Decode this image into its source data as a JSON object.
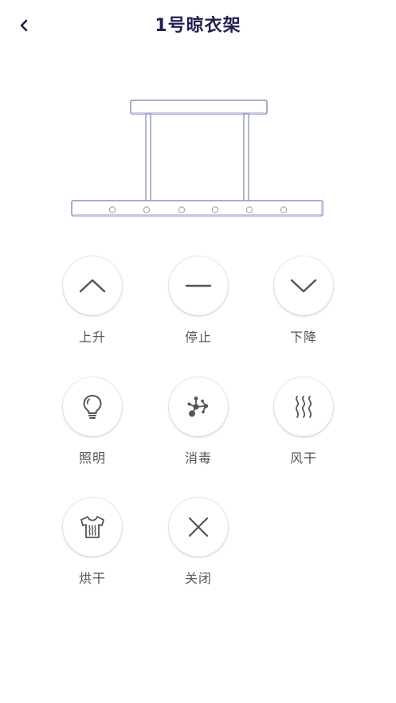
{
  "header": {
    "title": "1号晾衣架"
  },
  "controls": {
    "up": {
      "label": "上升",
      "icon": "chevron-up-icon"
    },
    "stop": {
      "label": "停止",
      "icon": "minus-icon"
    },
    "down": {
      "label": "下降",
      "icon": "chevron-down-icon"
    },
    "light": {
      "label": "照明",
      "icon": "lightbulb-icon"
    },
    "disinfect": {
      "label": "消毒",
      "icon": "molecule-icon"
    },
    "air_dry": {
      "label": "风干",
      "icon": "heat-waves-icon"
    },
    "heat_dry": {
      "label": "烘干",
      "icon": "shirt-dry-icon"
    },
    "close": {
      "label": "关闭",
      "icon": "close-icon"
    }
  },
  "colors": {
    "title": "#1d1f4f",
    "icon": "#555555",
    "rack_outline": "#8a92b8"
  }
}
